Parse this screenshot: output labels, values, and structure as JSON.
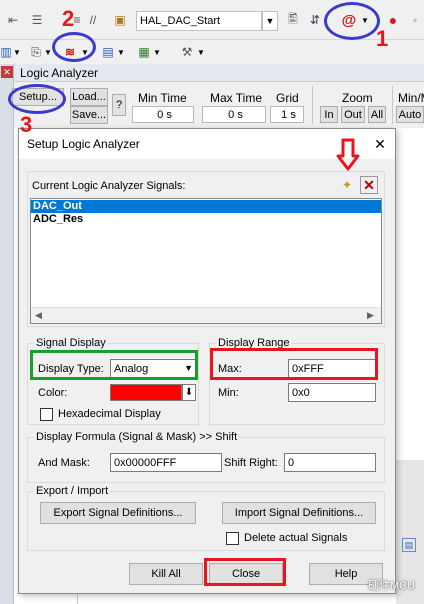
{
  "toolbar": {
    "target_name": "HAL_DAC_Start"
  },
  "logic_analyzer": {
    "title": "Logic Analyzer",
    "setup_label": "Setup...",
    "load_label": "Load...",
    "save_label": "Save...",
    "help_label": "?",
    "min_time_label": "Min Time",
    "min_time_value": "0 s",
    "max_time_label": "Max Time",
    "max_time_value": "0 s",
    "grid_label": "Grid",
    "grid_value": "1 s",
    "zoom_label": "Zoom",
    "zoom_in": "In",
    "zoom_out": "Out",
    "zoom_all": "All",
    "minmax_label": "Min/M",
    "auto_label": "Auto"
  },
  "dialog": {
    "title": "Setup Logic Analyzer",
    "close_glyph": "✕",
    "signals_label": "Current Logic Analyzer Signals:",
    "signals": [
      "DAC_Out",
      "ADC_Res"
    ],
    "signal_display_title": "Signal Display",
    "display_type_label": "Display Type:",
    "display_type_value": "Analog",
    "color_label": "Color:",
    "color_value": "#ff0000",
    "hexadecimal_label": "Hexadecimal Display",
    "display_range_title": "Display Range",
    "max_label": "Max:",
    "max_value": "0xFFF",
    "min_label": "Min:",
    "min_value": "0x0",
    "formula_title": "Display Formula (Signal & Mask) >> Shift",
    "and_mask_label": "And Mask:",
    "and_mask_value": "0x00000FFF",
    "shift_right_label": "Shift Right:",
    "shift_right_value": "0",
    "export_title": "Export / Import",
    "export_button": "Export Signal Definitions...",
    "import_button": "Import Signal Definitions...",
    "delete_signals_label": "Delete actual Signals",
    "kill_all_button": "Kill All",
    "close_button": "Close",
    "help_button": "Help"
  },
  "annotations": {
    "step1": "1",
    "step2": "2",
    "step3": "3"
  },
  "watermark": "硬件MCU",
  "colors": {
    "annotation_red": "#e8141e",
    "annotation_blue": "#3a3acf",
    "annotation_green": "#1a9e2a",
    "selection_blue": "#0078d7"
  }
}
